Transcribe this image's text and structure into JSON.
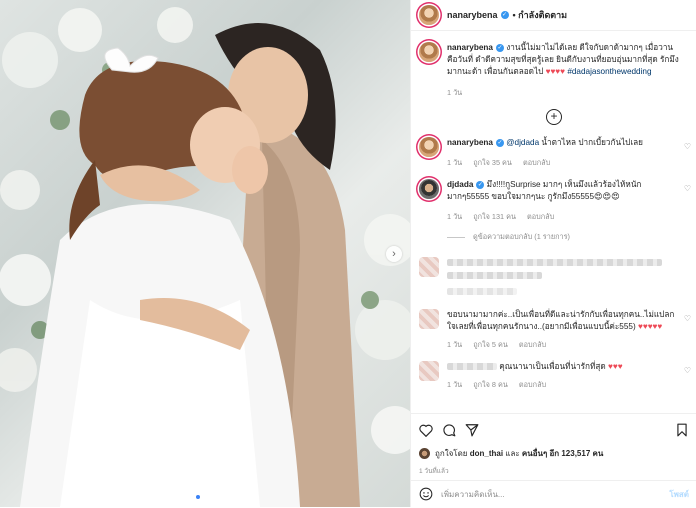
{
  "post": {
    "username": "nanarybena",
    "follow_label": "• กำลังติดตาม",
    "caption": "งานนี้ไม่มาไม่ได้เลย ดีใจกับดาด้ามากๆ เมื่อวานคือวันที่ ดำดีความสุขที่สุดรู้เลย ยินดีกับงานที่ยอบอุ่นมากที่สุด รักมึงมากนะด้า เพื่อนกันตลอดไป",
    "caption_hearts": "♥♥♥♥",
    "hashtag": "#dadajasonthewedding",
    "caption_time": "1 วัน"
  },
  "comments": [
    {
      "username": "nanarybena",
      "mention": "@djdada",
      "text": " น้ำตาไหล ปากเบี้ยวกันไปเลย",
      "time": "1 วัน",
      "likes": "ถูกใจ 35 คน",
      "reply": "ตอบกลับ"
    },
    {
      "username": "djdada",
      "text": "มึง!!!!กูSurprise มากๆ เห็นมึงแล้วร้องไห้หนักมากๆ55555 ขอบใจมากๆนะ กูรักมึง55555",
      "emoji": "😍😍😍",
      "time": "1 วัน",
      "likes": "ถูกใจ 131 คน",
      "reply": "ตอบกลับ",
      "view_replies": "ดูข้อความตอบกลับ (1 รายการ)"
    },
    {
      "text": "ขอบนามามากค่ะ..เป็นเพื่อนที่ดีและน่ารักกับเพื่อนทุกคน..ไม่แปลกใจเลยที่เพื่อนทุกคนรักนาง..(อยากมีเพื่อนแบบนี้ค่ะ555)",
      "hearts": "♥♥♥♥♥",
      "time": "1 วัน",
      "likes": "ถูกใจ 5 คน",
      "reply": "ตอบกลับ"
    },
    {
      "text": "คุณนานาเป็นเพื่อนที่น่ารักที่สุด",
      "hearts": "♥♥♥",
      "time": "1 วัน",
      "likes": "ถูกใจ 8 คน",
      "reply": "ตอบกลับ"
    }
  ],
  "actions": {
    "liked_by_prefix": "ถูกใจโดย",
    "liked_by_user": "don_thai",
    "liked_by_suffix": "และ",
    "others": "คนอื่นๆ อีก 123,517 คน",
    "posted": "1 วันที่แล้ว"
  },
  "composer": {
    "placeholder": "เพิ่มความคิดเห็น...",
    "post_label": "โพสต์"
  },
  "icons": {
    "like": "heart-icon",
    "comment": "comment-icon",
    "share": "share-icon",
    "save": "bookmark-icon",
    "emoji": "smiley-icon",
    "load_more": "plus-circle-icon",
    "next": "chevron-right-icon"
  }
}
